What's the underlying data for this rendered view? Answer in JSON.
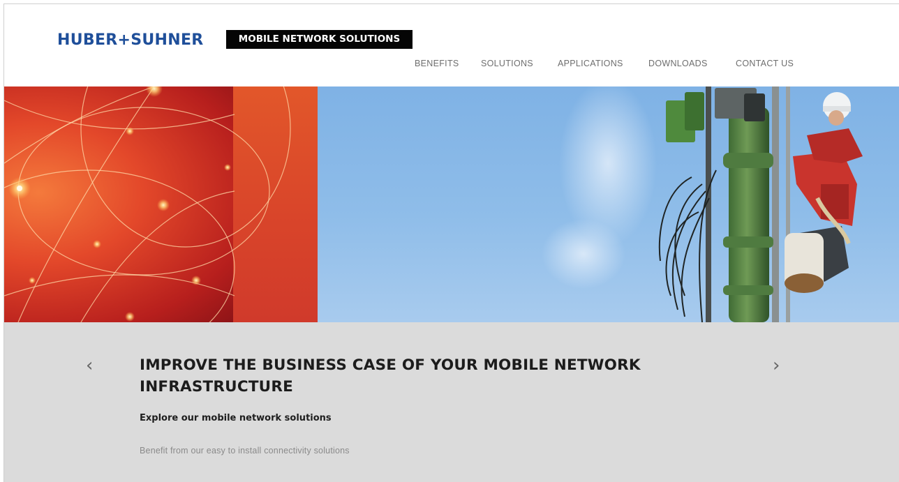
{
  "header": {
    "logo_text": "HUBER+SUHNER",
    "tagline": "MOBILE NETWORK SOLUTIONS"
  },
  "nav": {
    "items": [
      {
        "label": "BENEFITS"
      },
      {
        "label": "SOLUTIONS"
      },
      {
        "label": "APPLICATIONS"
      },
      {
        "label": "DOWNLOADS"
      },
      {
        "label": "CONTACT US"
      }
    ]
  },
  "hero": {
    "image_subject": "technician climbing green mobile antenna mast against blue sky, left panel red fiber-light graphic"
  },
  "slide": {
    "prev_label": "‹",
    "next_label": "›",
    "headline_line1": "IMPROVE THE BUSINESS CASE OF YOUR MOBILE NETWORK",
    "headline_line2": "INFRASTRUCTURE",
    "subheading": "Explore our mobile network solutions",
    "description": "Benefit from our easy to install connectivity solutions"
  },
  "colors": {
    "brand_blue": "#1f4f9a",
    "tagline_bg": "#050505",
    "content_bg": "#dbdbdb",
    "nav_text": "#6e6e6e"
  }
}
